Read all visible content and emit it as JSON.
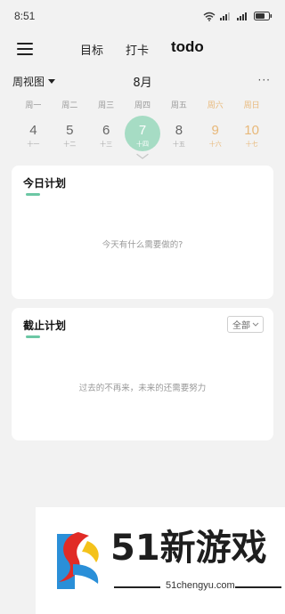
{
  "status_bar": {
    "time": "8:51"
  },
  "nav": {
    "tabs": [
      {
        "label": "目标"
      },
      {
        "label": "打卡"
      },
      {
        "label": "todo"
      }
    ]
  },
  "calendar": {
    "view_mode": "周视图",
    "month": "8月",
    "more": "···",
    "weekdays": [
      "周一",
      "周二",
      "周三",
      "周四",
      "周五",
      "周六",
      "周日"
    ],
    "days": [
      {
        "num": "4",
        "lunar": "十一"
      },
      {
        "num": "5",
        "lunar": "十二"
      },
      {
        "num": "6",
        "lunar": "十三"
      },
      {
        "num": "7",
        "lunar": "十四"
      },
      {
        "num": "8",
        "lunar": "十五"
      },
      {
        "num": "9",
        "lunar": "十六"
      },
      {
        "num": "10",
        "lunar": "十七"
      }
    ],
    "selected_index": 3
  },
  "today_plan": {
    "title": "今日计划",
    "empty_text": "今天有什么需要做的?"
  },
  "deadline_plan": {
    "title": "截止计划",
    "filter": "全部",
    "empty_text": "过去的不再来，未来的还需要努力"
  },
  "watermark": {
    "brand": "51新游戏",
    "url": "51chengyu.com"
  },
  "colors": {
    "accent": "#6cc7a4",
    "selected_day": "#a6dcc4",
    "weekend": "#e8b879"
  }
}
